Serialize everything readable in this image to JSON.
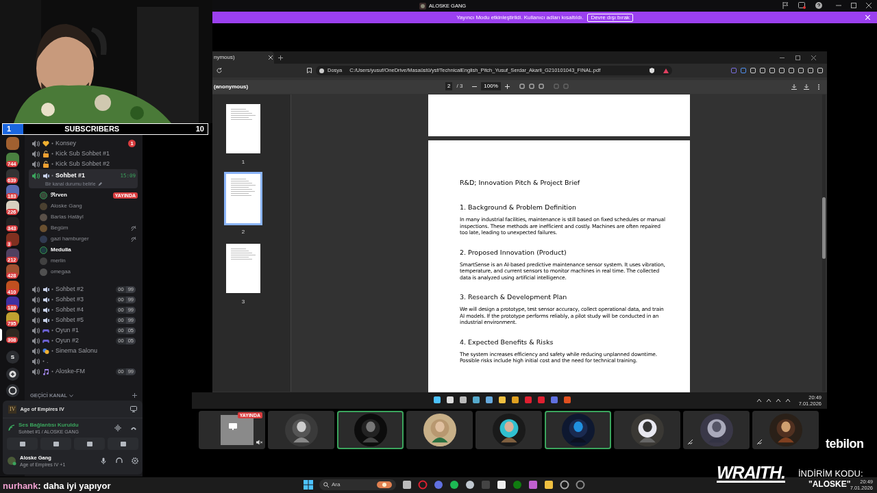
{
  "webcam": {
    "kind": "picture"
  },
  "subscriber_goal": {
    "current": "1",
    "label": "SUBSCRIBERS",
    "goal": "10",
    "level": 0.1
  },
  "server_rail": [
    {
      "selected": false
    },
    {
      "badge": "744",
      "selected": false
    },
    {
      "badge": "639",
      "selected": false
    },
    {
      "badge": "183",
      "selected": false
    },
    {
      "badge": "226",
      "selected": false
    },
    {
      "badge": "343",
      "selected": false
    },
    {
      "badge": "3",
      "selected": false
    },
    {
      "badge": "212",
      "selected": false
    },
    {
      "badge": "428",
      "selected": false
    },
    {
      "badge": "410",
      "selected": false
    },
    {
      "badge": "189",
      "selected": false
    },
    {
      "badge": "795",
      "selected": false
    },
    {
      "badge": "308",
      "selected": true
    }
  ],
  "server_letter": "S",
  "channels": [
    {
      "name": "Konsey",
      "kind": "heart",
      "mention": "1",
      "selected": false
    },
    {
      "name": "Kick Sub Sohbet #1",
      "kind": "lock",
      "selected": false
    },
    {
      "name": "Kick Sub Sohbet #2",
      "kind": "lock",
      "selected": false
    },
    {
      "name": "Sohbet #1",
      "kind": "speaker",
      "selected": true,
      "time": "15:09",
      "status": "Bir kanal durumu belirle",
      "members": [
        {
          "name": "ℜrven",
          "speaking": true,
          "live": "YAYINDA",
          "deafened": false
        },
        {
          "name": "Aloske Gang",
          "speaking": false,
          "deafened": false
        },
        {
          "name": "Barlas Hatâyî",
          "speaking": false,
          "deafened": false
        },
        {
          "name": "Begüm",
          "speaking": false,
          "deafened": true
        },
        {
          "name": "gazi hamburger",
          "speaking": false,
          "deafened": true
        },
        {
          "name": "Medulla",
          "speaking": true,
          "deafened": false
        },
        {
          "name": "merlin",
          "speaking": false,
          "deafened": false
        },
        {
          "name": "omegaa",
          "speaking": false,
          "deafened": false
        }
      ]
    },
    {
      "name": "Sohbet #2",
      "kind": "speaker",
      "selected": false,
      "counter": [
        "00",
        "99"
      ]
    },
    {
      "name": "Sohbet #3",
      "kind": "speaker",
      "selected": false,
      "counter": [
        "00",
        "99"
      ]
    },
    {
      "name": "Sohbet #4",
      "kind": "speaker",
      "selected": false,
      "counter": [
        "00",
        "99"
      ]
    },
    {
      "name": "Sohbet #5",
      "kind": "speaker",
      "selected": false,
      "counter": [
        "00",
        "99"
      ]
    },
    {
      "name": "Oyun #1",
      "kind": "gamepad",
      "selected": false,
      "counter": [
        "00",
        "05"
      ]
    },
    {
      "name": "Oyun #2",
      "kind": "gamepad",
      "selected": false,
      "counter": [
        "00",
        "05"
      ]
    },
    {
      "name": "Sinema Salonu",
      "kind": "mask",
      "selected": false
    },
    {
      "name": ".",
      "kind": "none",
      "selected": false
    },
    {
      "name": "Aloske-FM",
      "kind": "note",
      "selected": false,
      "counter": [
        "00",
        "99"
      ]
    }
  ],
  "category": "GEÇİCİ KANAL",
  "activity": {
    "game": "Age of Empires IV",
    "game_badge": "IV"
  },
  "voice": {
    "status": "Ses Bağlantısı Kuruldu",
    "channel": "Sohbet #1 / ALOSKE GANG"
  },
  "user": {
    "name": "Aloske Gang",
    "activity": "Age of Empires IV +1"
  },
  "chat": {
    "user": "nurhank",
    "message": ": daha iyi yapıyor"
  },
  "app_title": "ALOSKE GANG",
  "banner": {
    "text": "Yayıncı Modu etkinleştirildi. Kullanıcı adları kısaltıldı.",
    "button": "Devre dışı bırak"
  },
  "browser": {
    "tab": "nymous)",
    "scheme": "Dosya",
    "url": "C:/Users/yusuf/OneDrive/Masaüstü/ysf/TechnicalEnglish_Pitch_Yusuf_Serdar_Akarli_G210101043_FINAL.pdf"
  },
  "pdf": {
    "title": "(anonymous)",
    "page": "2",
    "pages": "/ 3",
    "zoom": "100%",
    "thumbnails": [
      {
        "label": "1",
        "selected": false
      },
      {
        "label": "2",
        "selected": true
      },
      {
        "label": "3",
        "selected": false
      }
    ],
    "heading": "R&D; Innovation Pitch & Project Brief",
    "sections": [
      {
        "title": "1. Background & Problem Definition",
        "body": "In many industrial facilities, maintenance is still based on fixed schedules or manual inspections. These methods are inefficient and costly. Machines are often repaired too late, leading to unexpected failures."
      },
      {
        "title": "2. Proposed Innovation (Product)",
        "body": "SmartSense is an AI-based predictive maintenance sensor system. It uses vibration, temperature, and current sensors to monitor machines in real time. The collected data is analyzed using artificial intelligence."
      },
      {
        "title": "3. Research & Development Plan",
        "body": "We will design a prototype, test sensor accuracy, collect operational data, and train AI models. If the prototype performs reliably, a pilot study will be conducted in an industrial environment."
      },
      {
        "title": "4. Expected Benefits & Risks",
        "body": "The system increases efficiency and safety while reducing unplanned downtime. Possible risks include high initial cost and the need for technical training."
      }
    ]
  },
  "inner_clock": {
    "time": "20:49",
    "date": "7.01.2026"
  },
  "tiles": [
    {
      "kind": "screen",
      "live": "YAYINDA",
      "speaking": false,
      "muted": false
    },
    {
      "kind": "picture",
      "speaking": false,
      "muted": false
    },
    {
      "kind": "picture",
      "speaking": true,
      "muted": false
    },
    {
      "kind": "picture",
      "speaking": false,
      "muted": false
    },
    {
      "kind": "picture",
      "speaking": false,
      "muted": false
    },
    {
      "kind": "picture",
      "speaking": true,
      "muted": false
    },
    {
      "kind": "picture",
      "speaking": false,
      "muted": false
    },
    {
      "kind": "picture",
      "speaking": false,
      "muted": true
    },
    {
      "kind": "picture",
      "speaking": false,
      "muted": true
    }
  ],
  "taskbar": {
    "search": "Ara",
    "time": "20:49",
    "date": "7.01.2026"
  },
  "sponsors": {
    "brand": "tebilon",
    "product": "WRAITH.",
    "code_label": "İNDİRİM KODU:",
    "code": "\"ALOSKE\""
  }
}
